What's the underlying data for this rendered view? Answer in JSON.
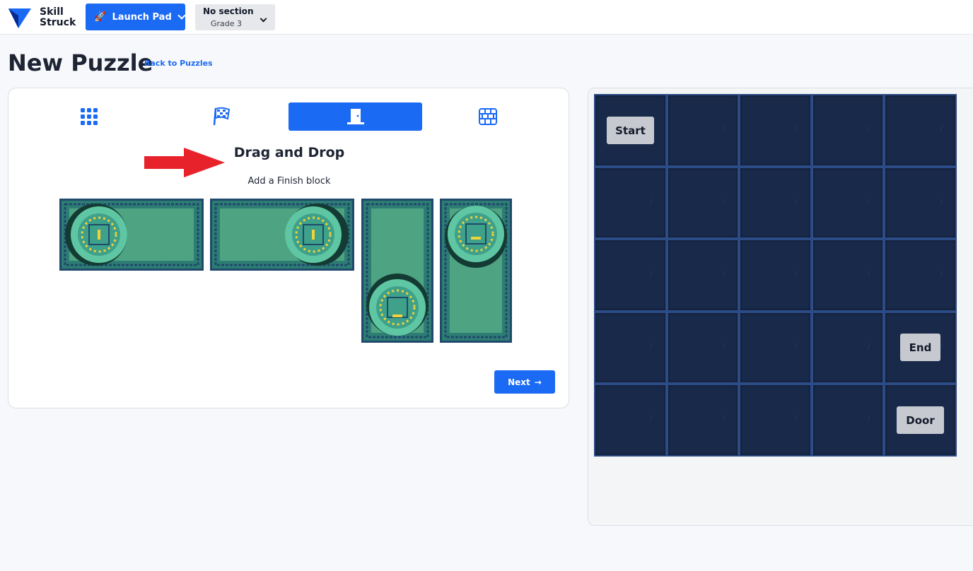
{
  "header": {
    "logo_line1": "Skill",
    "logo_line2": "Struck",
    "launch_label": "Launch Pad",
    "section_title": "No section",
    "section_grade": "Grade 3"
  },
  "page": {
    "title": "New Puzzle",
    "back_link": "Back to Puzzles"
  },
  "wizard": {
    "steps": [
      "grid-icon",
      "flag-icon",
      "door-icon",
      "brick-wall-icon"
    ],
    "active_step": 2,
    "heading": "Drag and Drop",
    "instruction": "Add a Finish block",
    "next_label": "Next",
    "next_arrow": "→"
  },
  "board": {
    "rows": 5,
    "cols": 5,
    "start_label": "Start",
    "end_label": "End",
    "door_label": "Door"
  },
  "colors": {
    "accent": "#1a6af4",
    "board_bg": "#19294a",
    "board_line": "#2c4c87",
    "tile_green": "#4ea482",
    "arrow_red": "#e8222a"
  }
}
